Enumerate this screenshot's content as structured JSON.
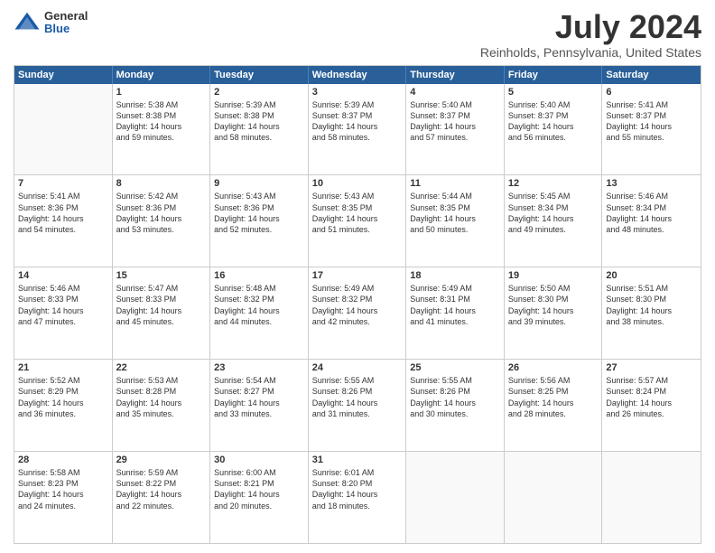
{
  "logo": {
    "general": "General",
    "blue": "Blue"
  },
  "title": {
    "month_year": "July 2024",
    "location": "Reinholds, Pennsylvania, United States"
  },
  "headers": [
    "Sunday",
    "Monday",
    "Tuesday",
    "Wednesday",
    "Thursday",
    "Friday",
    "Saturday"
  ],
  "weeks": [
    [
      {
        "day": "",
        "lines": []
      },
      {
        "day": "1",
        "lines": [
          "Sunrise: 5:38 AM",
          "Sunset: 8:38 PM",
          "Daylight: 14 hours",
          "and 59 minutes."
        ]
      },
      {
        "day": "2",
        "lines": [
          "Sunrise: 5:39 AM",
          "Sunset: 8:38 PM",
          "Daylight: 14 hours",
          "and 58 minutes."
        ]
      },
      {
        "day": "3",
        "lines": [
          "Sunrise: 5:39 AM",
          "Sunset: 8:37 PM",
          "Daylight: 14 hours",
          "and 58 minutes."
        ]
      },
      {
        "day": "4",
        "lines": [
          "Sunrise: 5:40 AM",
          "Sunset: 8:37 PM",
          "Daylight: 14 hours",
          "and 57 minutes."
        ]
      },
      {
        "day": "5",
        "lines": [
          "Sunrise: 5:40 AM",
          "Sunset: 8:37 PM",
          "Daylight: 14 hours",
          "and 56 minutes."
        ]
      },
      {
        "day": "6",
        "lines": [
          "Sunrise: 5:41 AM",
          "Sunset: 8:37 PM",
          "Daylight: 14 hours",
          "and 55 minutes."
        ]
      }
    ],
    [
      {
        "day": "7",
        "lines": [
          "Sunrise: 5:41 AM",
          "Sunset: 8:36 PM",
          "Daylight: 14 hours",
          "and 54 minutes."
        ]
      },
      {
        "day": "8",
        "lines": [
          "Sunrise: 5:42 AM",
          "Sunset: 8:36 PM",
          "Daylight: 14 hours",
          "and 53 minutes."
        ]
      },
      {
        "day": "9",
        "lines": [
          "Sunrise: 5:43 AM",
          "Sunset: 8:36 PM",
          "Daylight: 14 hours",
          "and 52 minutes."
        ]
      },
      {
        "day": "10",
        "lines": [
          "Sunrise: 5:43 AM",
          "Sunset: 8:35 PM",
          "Daylight: 14 hours",
          "and 51 minutes."
        ]
      },
      {
        "day": "11",
        "lines": [
          "Sunrise: 5:44 AM",
          "Sunset: 8:35 PM",
          "Daylight: 14 hours",
          "and 50 minutes."
        ]
      },
      {
        "day": "12",
        "lines": [
          "Sunrise: 5:45 AM",
          "Sunset: 8:34 PM",
          "Daylight: 14 hours",
          "and 49 minutes."
        ]
      },
      {
        "day": "13",
        "lines": [
          "Sunrise: 5:46 AM",
          "Sunset: 8:34 PM",
          "Daylight: 14 hours",
          "and 48 minutes."
        ]
      }
    ],
    [
      {
        "day": "14",
        "lines": [
          "Sunrise: 5:46 AM",
          "Sunset: 8:33 PM",
          "Daylight: 14 hours",
          "and 47 minutes."
        ]
      },
      {
        "day": "15",
        "lines": [
          "Sunrise: 5:47 AM",
          "Sunset: 8:33 PM",
          "Daylight: 14 hours",
          "and 45 minutes."
        ]
      },
      {
        "day": "16",
        "lines": [
          "Sunrise: 5:48 AM",
          "Sunset: 8:32 PM",
          "Daylight: 14 hours",
          "and 44 minutes."
        ]
      },
      {
        "day": "17",
        "lines": [
          "Sunrise: 5:49 AM",
          "Sunset: 8:32 PM",
          "Daylight: 14 hours",
          "and 42 minutes."
        ]
      },
      {
        "day": "18",
        "lines": [
          "Sunrise: 5:49 AM",
          "Sunset: 8:31 PM",
          "Daylight: 14 hours",
          "and 41 minutes."
        ]
      },
      {
        "day": "19",
        "lines": [
          "Sunrise: 5:50 AM",
          "Sunset: 8:30 PM",
          "Daylight: 14 hours",
          "and 39 minutes."
        ]
      },
      {
        "day": "20",
        "lines": [
          "Sunrise: 5:51 AM",
          "Sunset: 8:30 PM",
          "Daylight: 14 hours",
          "and 38 minutes."
        ]
      }
    ],
    [
      {
        "day": "21",
        "lines": [
          "Sunrise: 5:52 AM",
          "Sunset: 8:29 PM",
          "Daylight: 14 hours",
          "and 36 minutes."
        ]
      },
      {
        "day": "22",
        "lines": [
          "Sunrise: 5:53 AM",
          "Sunset: 8:28 PM",
          "Daylight: 14 hours",
          "and 35 minutes."
        ]
      },
      {
        "day": "23",
        "lines": [
          "Sunrise: 5:54 AM",
          "Sunset: 8:27 PM",
          "Daylight: 14 hours",
          "and 33 minutes."
        ]
      },
      {
        "day": "24",
        "lines": [
          "Sunrise: 5:55 AM",
          "Sunset: 8:26 PM",
          "Daylight: 14 hours",
          "and 31 minutes."
        ]
      },
      {
        "day": "25",
        "lines": [
          "Sunrise: 5:55 AM",
          "Sunset: 8:26 PM",
          "Daylight: 14 hours",
          "and 30 minutes."
        ]
      },
      {
        "day": "26",
        "lines": [
          "Sunrise: 5:56 AM",
          "Sunset: 8:25 PM",
          "Daylight: 14 hours",
          "and 28 minutes."
        ]
      },
      {
        "day": "27",
        "lines": [
          "Sunrise: 5:57 AM",
          "Sunset: 8:24 PM",
          "Daylight: 14 hours",
          "and 26 minutes."
        ]
      }
    ],
    [
      {
        "day": "28",
        "lines": [
          "Sunrise: 5:58 AM",
          "Sunset: 8:23 PM",
          "Daylight: 14 hours",
          "and 24 minutes."
        ]
      },
      {
        "day": "29",
        "lines": [
          "Sunrise: 5:59 AM",
          "Sunset: 8:22 PM",
          "Daylight: 14 hours",
          "and 22 minutes."
        ]
      },
      {
        "day": "30",
        "lines": [
          "Sunrise: 6:00 AM",
          "Sunset: 8:21 PM",
          "Daylight: 14 hours",
          "and 20 minutes."
        ]
      },
      {
        "day": "31",
        "lines": [
          "Sunrise: 6:01 AM",
          "Sunset: 8:20 PM",
          "Daylight: 14 hours",
          "and 18 minutes."
        ]
      },
      {
        "day": "",
        "lines": []
      },
      {
        "day": "",
        "lines": []
      },
      {
        "day": "",
        "lines": []
      }
    ]
  ]
}
